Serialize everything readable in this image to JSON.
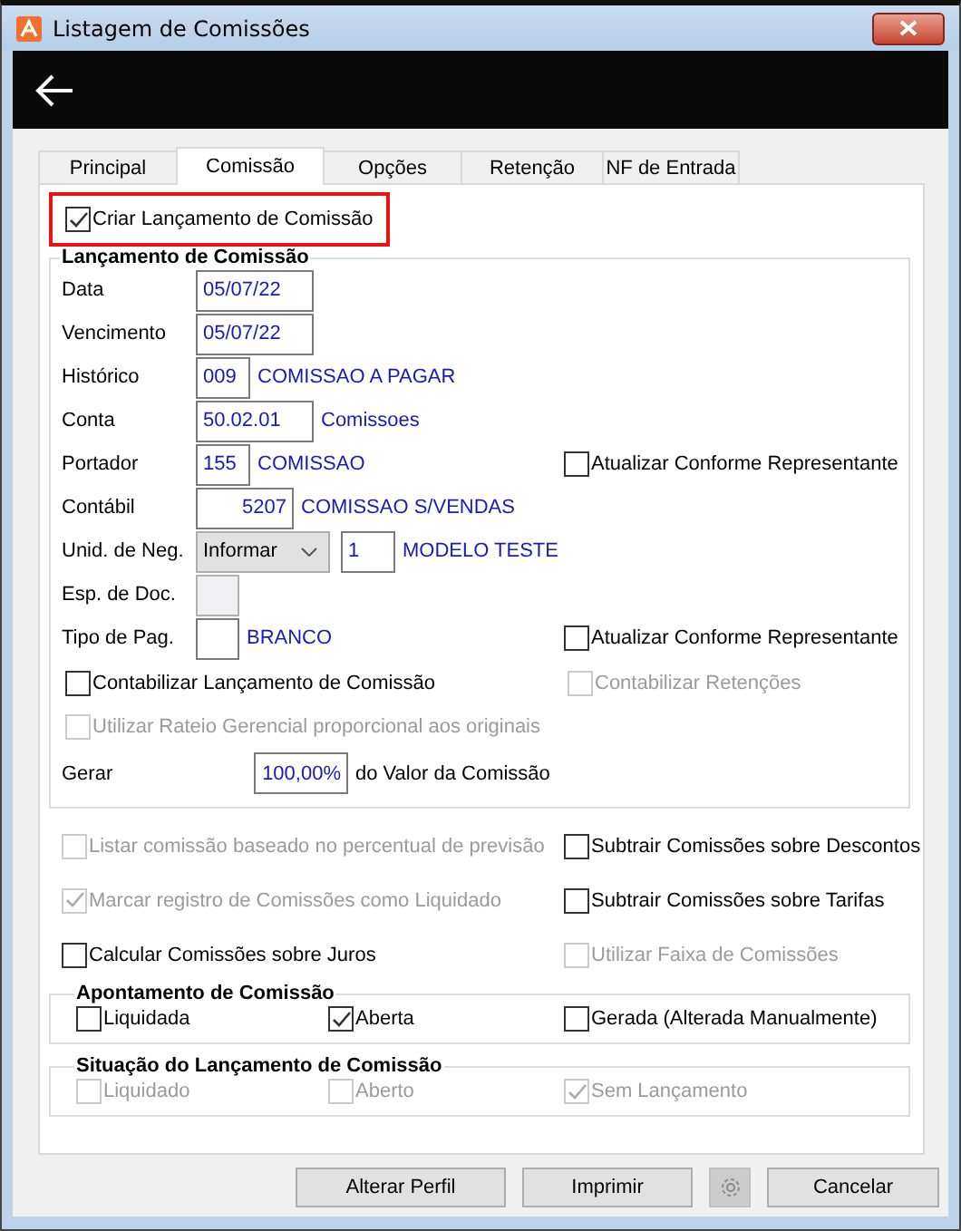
{
  "window": {
    "title": "Listagem de Comissões"
  },
  "tabs": [
    {
      "label": "Principal",
      "selected": false
    },
    {
      "label": "Comissão",
      "selected": true
    },
    {
      "label": "Opções",
      "selected": false
    },
    {
      "label": "Retenção",
      "selected": false
    },
    {
      "label": "NF de Entrada",
      "selected": false
    }
  ],
  "create_entry": {
    "label": "Criar Lançamento de Comissão",
    "checked": true,
    "highlighted": true
  },
  "entry_group": {
    "title": "Lançamento de Comissão",
    "fields": [
      {
        "kind": "date",
        "label": "Data",
        "value": "05/07/22"
      },
      {
        "kind": "date",
        "label": "Vencimento",
        "value": "05/07/22"
      },
      {
        "kind": "code",
        "label": "Histórico",
        "value": "009",
        "description": "COMISSAO A PAGAR"
      },
      {
        "kind": "date",
        "label": "Conta",
        "value": "50.02.01",
        "description": "Comissoes"
      },
      {
        "kind": "code",
        "label": "Portador",
        "value": "155",
        "description": "COMISSAO",
        "option": {
          "label": "Atualizar Conforme Representante",
          "checked": false,
          "disabled": false
        }
      },
      {
        "kind": "number",
        "label": "Contábil",
        "value": "5207",
        "description": "COMISSAO S/VENDAS"
      },
      {
        "kind": "select",
        "label": "Unid. de Neg.",
        "value": "Informar",
        "code": "1",
        "description": "MODELO TESTE"
      },
      {
        "kind": "blank",
        "label": "Esp. de Doc.",
        "disabled": true
      },
      {
        "kind": "blank",
        "label": "Tipo de Pag.",
        "disabled": false,
        "description": "BRANCO",
        "option": {
          "label": "Atualizar Conforme Representante",
          "checked": false,
          "disabled": false
        }
      }
    ],
    "checks": [
      {
        "label": "Contabilizar Lançamento de Comissão",
        "checked": false,
        "disabled": false
      },
      {
        "label": "Contabilizar Retenções",
        "checked": false,
        "disabled": true
      },
      {
        "label": "Utilizar Rateio Gerencial proporcional aos originais",
        "checked": false,
        "disabled": true
      }
    ],
    "generate": {
      "label": "Gerar",
      "value": "100,00%",
      "suffix": "do Valor da Comissão"
    }
  },
  "options": [
    {
      "label": "Listar comissão baseado no percentual de previsão",
      "checked": false,
      "disabled": true
    },
    {
      "label": "Subtrair Comissões sobre Descontos",
      "checked": false,
      "disabled": false
    },
    {
      "label": "Marcar registro de Comissões como Liquidado",
      "checked": true,
      "disabled": true
    },
    {
      "label": "Subtrair Comissões sobre Tarifas",
      "checked": false,
      "disabled": false
    },
    {
      "label": "Calcular Comissões sobre Juros",
      "checked": false,
      "disabled": false
    },
    {
      "label": "Utilizar Faixa de Comissões",
      "checked": false,
      "disabled": true
    }
  ],
  "appointment": {
    "title": "Apontamento de Comissão",
    "items": [
      {
        "label": "Liquidada",
        "checked": false,
        "disabled": false
      },
      {
        "label": "Aberta",
        "checked": true,
        "disabled": false
      },
      {
        "label": "Gerada (Alterada Manualmente)",
        "checked": false,
        "disabled": false
      }
    ]
  },
  "situation": {
    "title": "Situação do Lançamento de Comissão",
    "items": [
      {
        "label": "Liquidado",
        "checked": false,
        "disabled": true
      },
      {
        "label": "Aberto",
        "checked": false,
        "disabled": true
      },
      {
        "label": "Sem Lançamento",
        "checked": true,
        "disabled": true
      }
    ]
  },
  "buttons": [
    {
      "kind": "text",
      "label": "Alterar Perfil",
      "disabled": false
    },
    {
      "kind": "text",
      "label": "Imprimir",
      "disabled": false
    },
    {
      "kind": "settings",
      "disabled": true
    },
    {
      "kind": "text",
      "label": "Cancelar",
      "disabled": false
    }
  ]
}
